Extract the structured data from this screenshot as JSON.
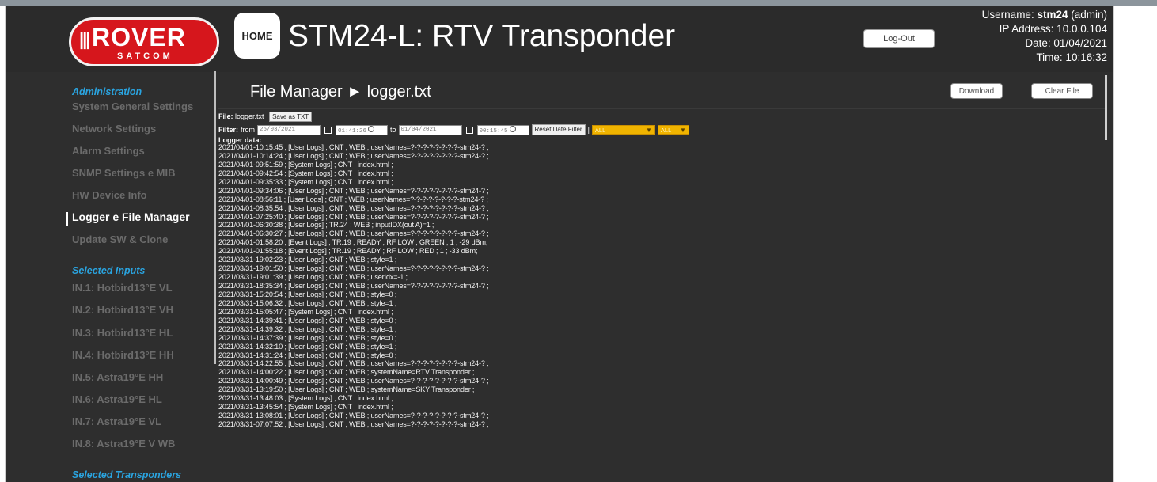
{
  "header": {
    "logo_text": "ROVER",
    "logo_sub": "SATCOM",
    "home_label": "HOME",
    "app_title": "STM24-L: RTV Transponder",
    "logout_label": "Log-Out",
    "username_prefix": "Username: ",
    "username": "stm24",
    "role": " (admin)",
    "ip_label": "IP Address: 10.0.0.104",
    "date_label": "Date: 01/04/2021",
    "time_label": "Time: 10:16:32"
  },
  "sidebar": {
    "administration_heading": "Administration",
    "admin_items": [
      "System General Settings",
      "Network Settings",
      "Alarm Settings",
      "SNMP Settings e MIB",
      "HW Device Info",
      "Logger e File Manager",
      "Update SW & Clone"
    ],
    "active_item": "Logger e File Manager",
    "inputs_heading": "Selected Inputs",
    "input_items": [
      "IN.1: Hotbird13°E VL",
      "IN.2: Hotbird13°E VH",
      "IN.3: Hotbird13°E HL",
      "IN.4: Hotbird13°E HH",
      "IN.5: Astra19°E HH",
      "IN.6: Astra19°E HL",
      "IN.7: Astra19°E VL",
      "IN.8: Astra19°E V WB"
    ],
    "transponders_heading": "Selected Transponders"
  },
  "main": {
    "page_title": "File Manager ► logger.txt",
    "download_label": "Download",
    "clear_label": "Clear File",
    "file_label": "File:",
    "file_name": "logger.txt",
    "save_txt_label": "Save as TXT",
    "filter_label": "Filter:",
    "from_label": "from",
    "from_date": "25/03/2021",
    "from_time": "01:41:26",
    "to_label": "to",
    "to_date": "01/04/2021",
    "to_time": "00:15:45",
    "reset_filter_label": "Reset Date Filter",
    "type_select": "ALL",
    "tr_select": "ALL",
    "logger_label": "Logger data:"
  },
  "logs": [
    "2021/04/01-10:15:45 ; [User Logs] ; CNT ; WEB ; userNames=?-?-?-?-?-?-?-?-stm24-? ;",
    "2021/04/01-10:14:24 ; [User Logs] ; CNT ; WEB ; userNames=?-?-?-?-?-?-?-?-stm24-? ;",
    "2021/04/01-09:51:59 ; [System Logs] ; CNT ; index.html ;",
    "2021/04/01-09:42:54 ; [System Logs] ; CNT ; index.html ;",
    "2021/04/01-09:35:33 ; [System Logs] ; CNT ; index.html ;",
    "2021/04/01-09:34:06 ; [User Logs] ; CNT ; WEB ; userNames=?-?-?-?-?-?-?-?-stm24-? ;",
    "2021/04/01-08:56:11 ; [User Logs] ; CNT ; WEB ; userNames=?-?-?-?-?-?-?-?-stm24-? ;",
    "2021/04/01-08:35:54 ; [User Logs] ; CNT ; WEB ; userNames=?-?-?-?-?-?-?-?-stm24-? ;",
    "2021/04/01-07:25:40 ; [User Logs] ; CNT ; WEB ; userNames=?-?-?-?-?-?-?-?-stm24-? ;",
    "2021/04/01-06:30:38 ; [User Logs] ; TR.24 ; WEB ; inputIDX(out A)=1 ;",
    "2021/04/01-06:30:27 ; [User Logs] ; CNT ; WEB ; userNames=?-?-?-?-?-?-?-?-stm24-? ;",
    "2021/04/01-01:58:20 ; [Event Logs] ; TR.19 ; READY ; RF LOW ; GREEN ; 1 ; -29 dBm;",
    "2021/04/01-01:55:18 ; [Event Logs] ; TR.19 ; READY ; RF LOW ; RED ; 1 ; -33 dBm;",
    "2021/03/31-19:02:23 ; [User Logs] ; CNT ; WEB ; style=1 ;",
    "2021/03/31-19:01:50 ; [User Logs] ; CNT ; WEB ; userNames=?-?-?-?-?-?-?-?-stm24-? ;",
    "2021/03/31-19:01:39 ; [User Logs] ; CNT ; WEB ; userIdx=-1 ;",
    "2021/03/31-18:35:34 ; [User Logs] ; CNT ; WEB ; userNames=?-?-?-?-?-?-?-?-stm24-? ;",
    "2021/03/31-15:20:54 ; [User Logs] ; CNT ; WEB ; style=0 ;",
    "2021/03/31-15:06:32 ; [User Logs] ; CNT ; WEB ; style=1 ;",
    "2021/03/31-15:05:47 ; [System Logs] ; CNT ; index.html ;",
    "2021/03/31-14:39:41 ; [User Logs] ; CNT ; WEB ; style=0 ;",
    "2021/03/31-14:39:32 ; [User Logs] ; CNT ; WEB ; style=1 ;",
    "2021/03/31-14:37:39 ; [User Logs] ; CNT ; WEB ; style=0 ;",
    "2021/03/31-14:32:10 ; [User Logs] ; CNT ; WEB ; style=1 ;",
    "2021/03/31-14:31:24 ; [User Logs] ; CNT ; WEB ; style=0 ;",
    "2021/03/31-14:22:55 ; [User Logs] ; CNT ; WEB ; userNames=?-?-?-?-?-?-?-?-stm24-? ;",
    "2021/03/31-14:00:22 ; [User Logs] ; CNT ; WEB ; systemName=RTV Transponder ;",
    "2021/03/31-14:00:49 ; [User Logs] ; CNT ; WEB ; userNames=?-?-?-?-?-?-?-?-stm24-? ;",
    "2021/03/31-13:19:50 ; [User Logs] ; CNT ; WEB ; systemName=SKY Transponder ;",
    "2021/03/31-13:48:03 ; [System Logs] ; CNT ; index.html ;",
    "2021/03/31-13:45:54 ; [System Logs] ; CNT ; index.html ;",
    "2021/03/31-13:08:01 ; [User Logs] ; CNT ; WEB ; userNames=?-?-?-?-?-?-?-?-stm24-? ;",
    "2021/03/31-07:07:52 ; [User Logs] ; CNT ; WEB ; userNames=?-?-?-?-?-?-?-?-stm24-? ;"
  ],
  "colors": {
    "background": "#2e2e2e",
    "accent_blue": "#2aa4e0",
    "logo_red": "#d6161c",
    "select_yellow": "#f0b400"
  }
}
